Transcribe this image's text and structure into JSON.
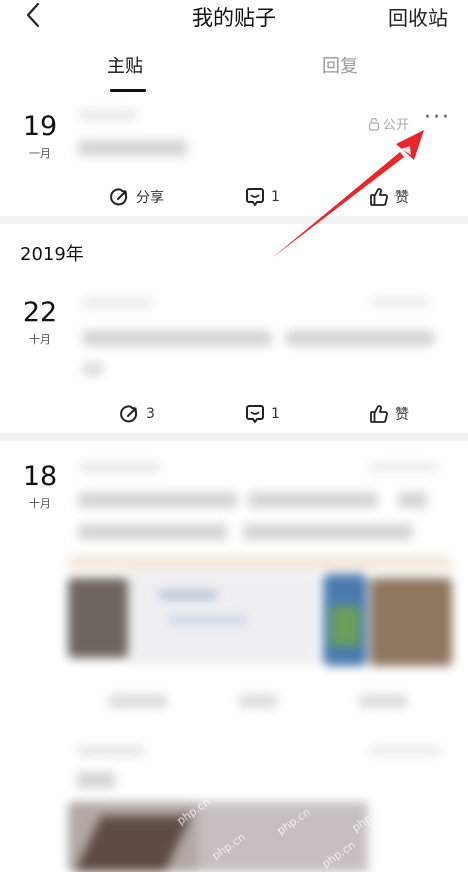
{
  "header": {
    "title": "我的贴子",
    "recycle_label": "回收站"
  },
  "tabs": [
    {
      "label": "主贴",
      "active": true
    },
    {
      "label": "回复",
      "active": false
    }
  ],
  "posts": [
    {
      "day": "19",
      "month": "一月",
      "visibility": "公开",
      "share_label": "分享",
      "comments": "1",
      "like_label": "赞"
    },
    {
      "day": "22",
      "month": "十月",
      "shares": "3",
      "comments": "1",
      "like_label": "赞"
    },
    {
      "day": "18",
      "month": "十月"
    }
  ],
  "year_label": "2019年",
  "watermark": "php.cn",
  "colors": {
    "arrow": "#e8262b",
    "separator": "#f2f2f2",
    "inactive_tab": "#999999"
  }
}
